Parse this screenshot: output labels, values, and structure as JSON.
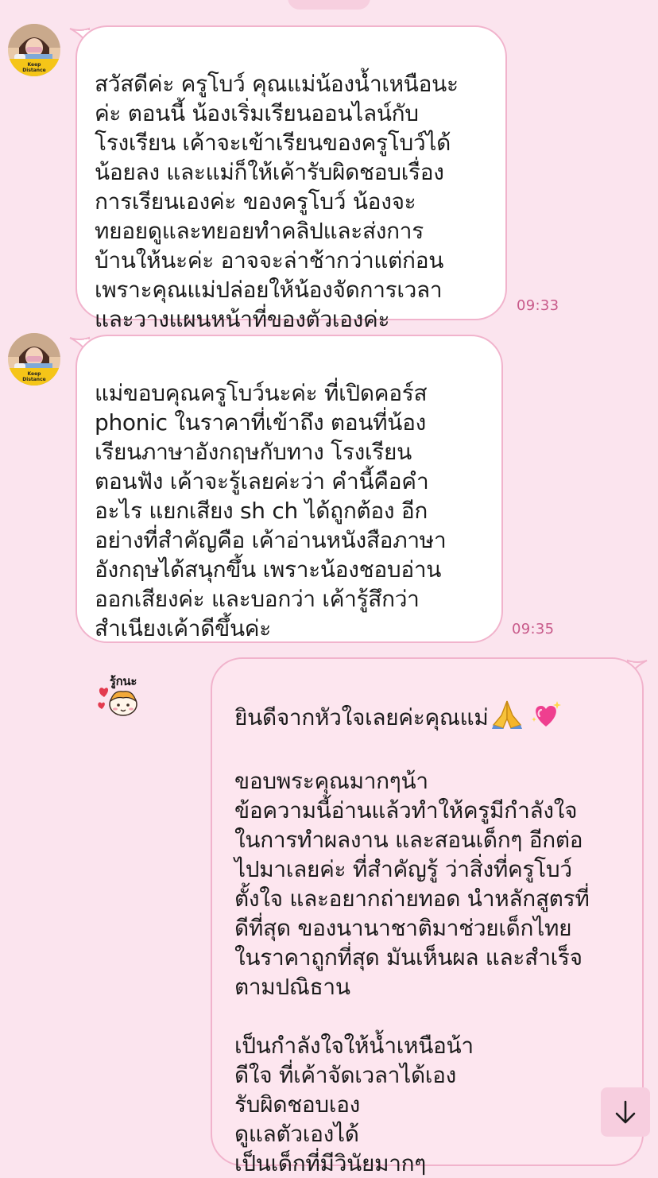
{
  "chat": {
    "messages": [
      {
        "sender": "incoming",
        "text": "สวัสดีค่ะ ครูโบว์ คุณแม่น้องน้ำเหนือนะ\nค่ะ ตอนนี้ น้องเริ่มเรียนออนไลน์กับ\nโรงเรียน เค้าจะเข้าเรียนของครูโบว์ได้\nน้อยลง และแม่ก็ให้เค้ารับผิดชอบเรื่อง\nการเรียนเองค่ะ ของครูโบว์ น้องจะ\nทยอยดูและทยอยทำคลิปและส่งการ\nบ้านให้นะค่ะ อาจจะล่าช้ากว่าแต่ก่อน\nเพราะคุณแม่ปล่อยให้น้องจัดการเวลา\nและวางแผนหน้าที่ของตัวเองค่ะ",
        "time": "09:33"
      },
      {
        "sender": "incoming",
        "text": "แม่ขอบคุณครูโบว์นะค่ะ ที่เปิดคอร์ส\nphonic ในราคาที่เข้าถึง ตอนที่น้อง\nเรียนภาษาอังกฤษกับทาง โรงเรียน\nตอนฟัง เค้าจะรู้เลยค่ะว่า คำนี้คือคำ\nอะไร แยกเสียง sh ch ได้ถูกต้อง อีก\nอย่างที่สำคัญคือ เค้าอ่านหนังสือภาษา\nอังกฤษได้สนุกขึ้น เพราะน้องชอบอ่าน\nออกเสียงค่ะ และบอกว่า เค้ารู้สึกว่า\nสำเนียงเค้าดีขึ้นค่ะ",
        "sticker_text": "รู้กนะ",
        "time": "09:35"
      },
      {
        "sender": "outgoing",
        "first_line": "ยินดีจากหัวใจเลยค่ะคุณแม่",
        "emoji": [
          "folded-hands-emoji",
          "sparkling-heart-emoji"
        ],
        "text": "ขอบพระคุณมากๆน้า\nข้อความนี้อ่านแล้วทำให้ครูมีกำลังใจ\nในการทำผลงาน และสอนเด็กๆ อีกต่อ\nไปมาเลยค่ะ ที่สำคัญรู้ ว่าสิ่งที่ครูโบว์\nตั้งใจ และอยากถ่ายทอด นำหลักสูตรที่\nดีที่สุด ของนานาชาติมาช่วยเด็กไทย\nในราคาถูกที่สุด มันเห็นผล และสำเร็จ\nตามปณิธาน\n\nเป็นกำลังใจให้น้ำเหนือน้า\nดีใจ ที่เค้าจัดเวลาได้เอง\nรับผิดชอบเอง\nดูแลตัวเองได้\nเป็นเด็กที่มีวินัยมากๆ"
      }
    ],
    "avatar_badge": [
      "Keep",
      "Distance"
    ]
  },
  "colors": {
    "background": "#fbe4ee",
    "bubble_border": "#f1b3cc",
    "incoming_bubble": "#ffffff",
    "outgoing_bubble": "#fde6ef",
    "timestamp": "#c85a8a"
  },
  "icons": {
    "scroll_down": "arrow-down-icon"
  }
}
